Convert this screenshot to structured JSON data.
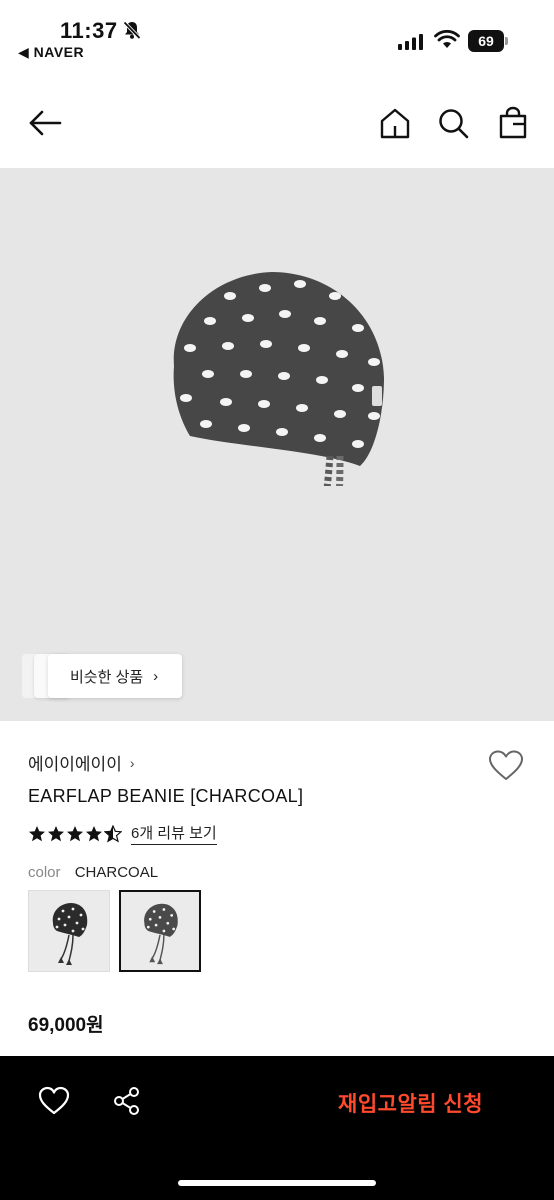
{
  "status_bar": {
    "time": "11:37",
    "back_app": "◀ NAVER",
    "battery": "69"
  },
  "hero": {
    "similar_label": "비슷한 상품",
    "chevron": "›"
  },
  "product": {
    "brand": "에이이에이이",
    "brand_chevron": "›",
    "title": "EARFLAP BEANIE [CHARCOAL]",
    "rating": 4.5,
    "review_link": "6개 리뷰 보기",
    "color_label": "color",
    "color_value": "CHARCOAL",
    "price": "69,000원"
  },
  "bottom_bar": {
    "restock_label": "재입고알림 신청"
  },
  "colors": {
    "restock": "#ff4a2e",
    "hero_bg": "#e6e6e6",
    "bottom_bg": "#000000"
  },
  "icons": [
    "back-arrow-icon",
    "home-icon",
    "search-icon",
    "shopping-bag-icon",
    "heart-icon",
    "share-icon",
    "star-icon",
    "bell-off-icon",
    "wifi-icon",
    "signal-icon"
  ]
}
